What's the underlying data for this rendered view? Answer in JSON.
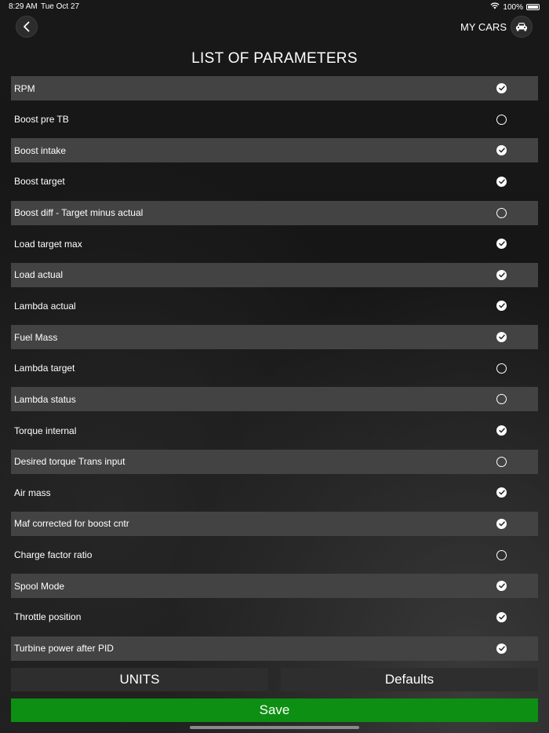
{
  "status_bar": {
    "time": "8:29 AM",
    "date": "Tue Oct 27",
    "battery": "100%"
  },
  "header": {
    "my_cars_label": "MY CARS"
  },
  "page_title": "LIST OF PARAMETERS",
  "parameters": [
    {
      "label": "RPM",
      "checked": true
    },
    {
      "label": "Boost pre TB",
      "checked": false
    },
    {
      "label": "Boost intake",
      "checked": true
    },
    {
      "label": "Boost target",
      "checked": true
    },
    {
      "label": "Boost diff - Target minus actual",
      "checked": false
    },
    {
      "label": "Load target max",
      "checked": true
    },
    {
      "label": "Load actual",
      "checked": true
    },
    {
      "label": "Lambda actual",
      "checked": true
    },
    {
      "label": "Fuel Mass",
      "checked": true
    },
    {
      "label": "Lambda target",
      "checked": false
    },
    {
      "label": "Lambda status",
      "checked": false
    },
    {
      "label": "Torque internal",
      "checked": true
    },
    {
      "label": "Desired torque Trans input",
      "checked": false
    },
    {
      "label": "Air mass",
      "checked": true
    },
    {
      "label": "Maf corrected for boost cntr",
      "checked": true
    },
    {
      "label": "Charge factor ratio",
      "checked": false
    },
    {
      "label": "Spool Mode",
      "checked": true
    },
    {
      "label": "Throttle position",
      "checked": true
    },
    {
      "label": "Turbine power after PID",
      "checked": true
    }
  ],
  "buttons": {
    "units": "UNITS",
    "defaults": "Defaults",
    "save": "Save"
  },
  "colors": {
    "save_green": "#0c8f12",
    "row_shade": "#434343",
    "background": "#131313"
  }
}
